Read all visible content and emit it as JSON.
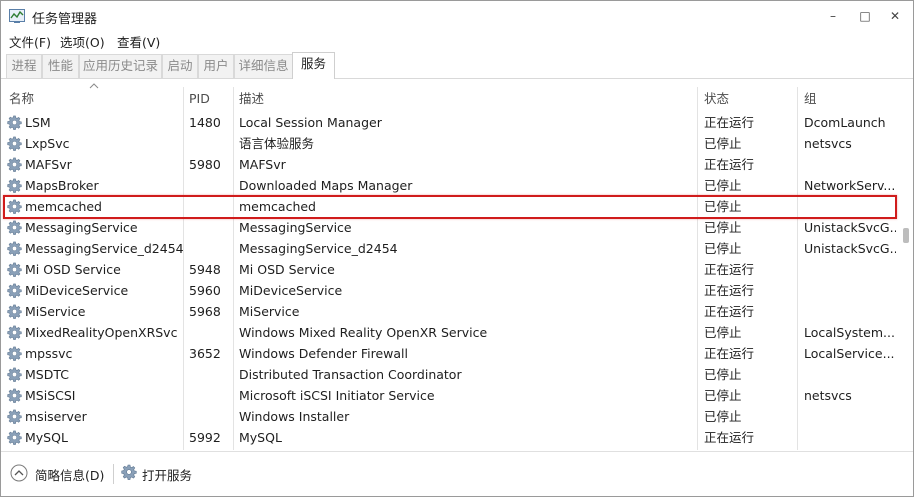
{
  "window": {
    "title": "任务管理器",
    "controls": {
      "minimize": "–",
      "maximize": "□",
      "close": "✕"
    }
  },
  "menu": [
    "文件(F)",
    "选项(O)",
    "查看(V)"
  ],
  "tabs": [
    "进程",
    "性能",
    "应用历史记录",
    "启动",
    "用户",
    "详细信息",
    "服务"
  ],
  "active_tab": "服务",
  "columns": {
    "name": "名称",
    "pid": "PID",
    "desc": "描述",
    "status": "状态",
    "group": "组"
  },
  "rows": [
    {
      "name": "LSM",
      "pid": "1480",
      "desc": "Local Session Manager",
      "status": "正在运行",
      "group": "DcomLaunch"
    },
    {
      "name": "LxpSvc",
      "pid": "",
      "desc": "语言体验服务",
      "status": "已停止",
      "group": "netsvcs"
    },
    {
      "name": "MAFSvr",
      "pid": "5980",
      "desc": "MAFSvr",
      "status": "正在运行",
      "group": ""
    },
    {
      "name": "MapsBroker",
      "pid": "",
      "desc": "Downloaded Maps Manager",
      "status": "已停止",
      "group": "NetworkServ..."
    },
    {
      "name": "memcached",
      "pid": "",
      "desc": "memcached",
      "status": "已停止",
      "group": ""
    },
    {
      "name": "MessagingService",
      "pid": "",
      "desc": "MessagingService",
      "status": "已停止",
      "group": "UnistackSvcG..."
    },
    {
      "name": "MessagingService_d2454",
      "pid": "",
      "desc": "MessagingService_d2454",
      "status": "已停止",
      "group": "UnistackSvcG..."
    },
    {
      "name": "Mi OSD Service",
      "pid": "5948",
      "desc": "Mi OSD Service",
      "status": "正在运行",
      "group": ""
    },
    {
      "name": "MiDeviceService",
      "pid": "5960",
      "desc": "MiDeviceService",
      "status": "正在运行",
      "group": ""
    },
    {
      "name": "MiService",
      "pid": "5968",
      "desc": "MiService",
      "status": "正在运行",
      "group": ""
    },
    {
      "name": "MixedRealityOpenXRSvc",
      "pid": "",
      "desc": "Windows Mixed Reality OpenXR Service",
      "status": "已停止",
      "group": "LocalSystem..."
    },
    {
      "name": "mpssvc",
      "pid": "3652",
      "desc": "Windows Defender Firewall",
      "status": "正在运行",
      "group": "LocalService..."
    },
    {
      "name": "MSDTC",
      "pid": "",
      "desc": "Distributed Transaction Coordinator",
      "status": "已停止",
      "group": ""
    },
    {
      "name": "MSiSCSI",
      "pid": "",
      "desc": "Microsoft iSCSI Initiator Service",
      "status": "已停止",
      "group": "netsvcs"
    },
    {
      "name": "msiserver",
      "pid": "",
      "desc": "Windows Installer",
      "status": "已停止",
      "group": ""
    },
    {
      "name": "MySQL",
      "pid": "5992",
      "desc": "MySQL",
      "status": "正在运行",
      "group": ""
    }
  ],
  "highlight_color": "#d01c1c",
  "footer": {
    "fewer_details": "简略信息(D)",
    "open_services": "打开服务"
  }
}
